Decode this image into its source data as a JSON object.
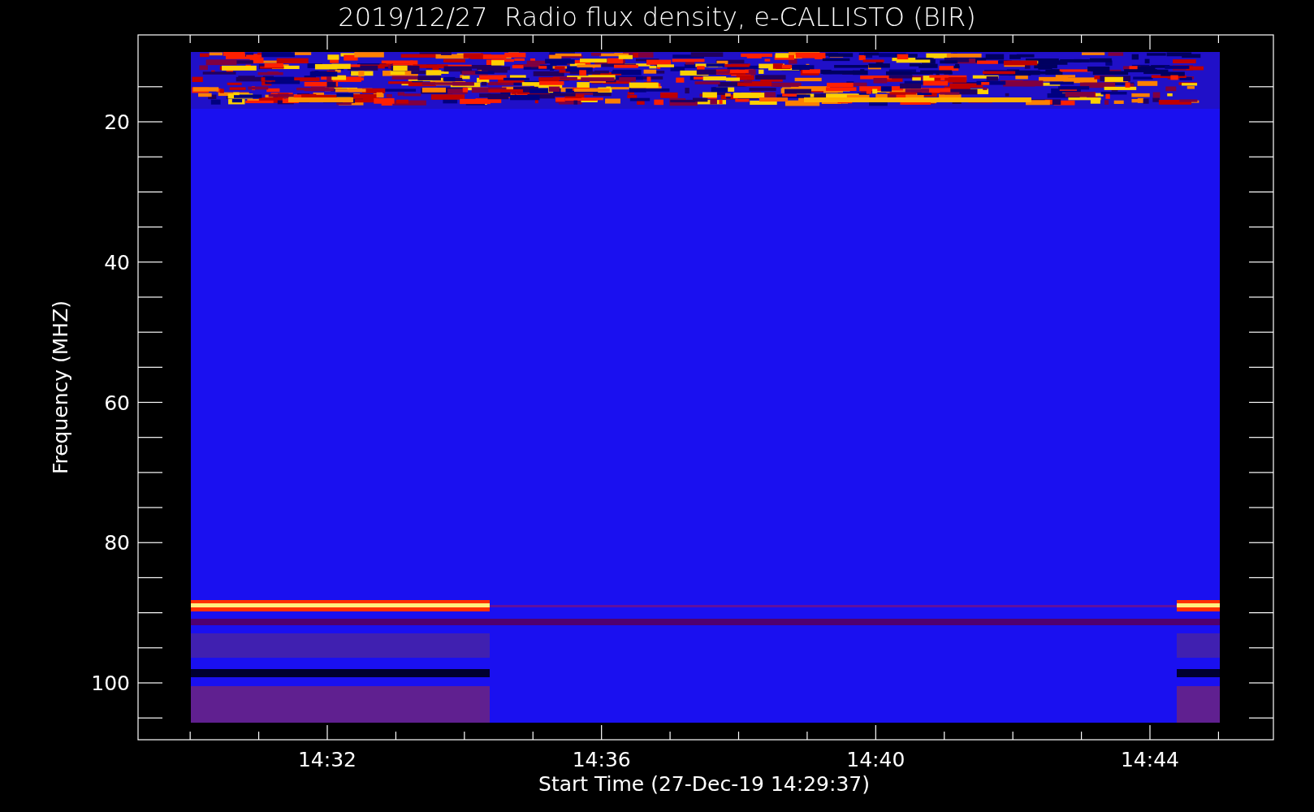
{
  "chart": {
    "title": "2019/12/27  Radio flux density, e-CALLISTO (BIR)",
    "ylabel": "Frequency (MHZ)",
    "xlabel": "Start Time (27-Dec-19 14:29:37)",
    "yticks": [
      "20",
      "40",
      "60",
      "80",
      "100"
    ],
    "xticks": [
      "14:32",
      "14:36",
      "14:40",
      "14:44"
    ]
  }
}
